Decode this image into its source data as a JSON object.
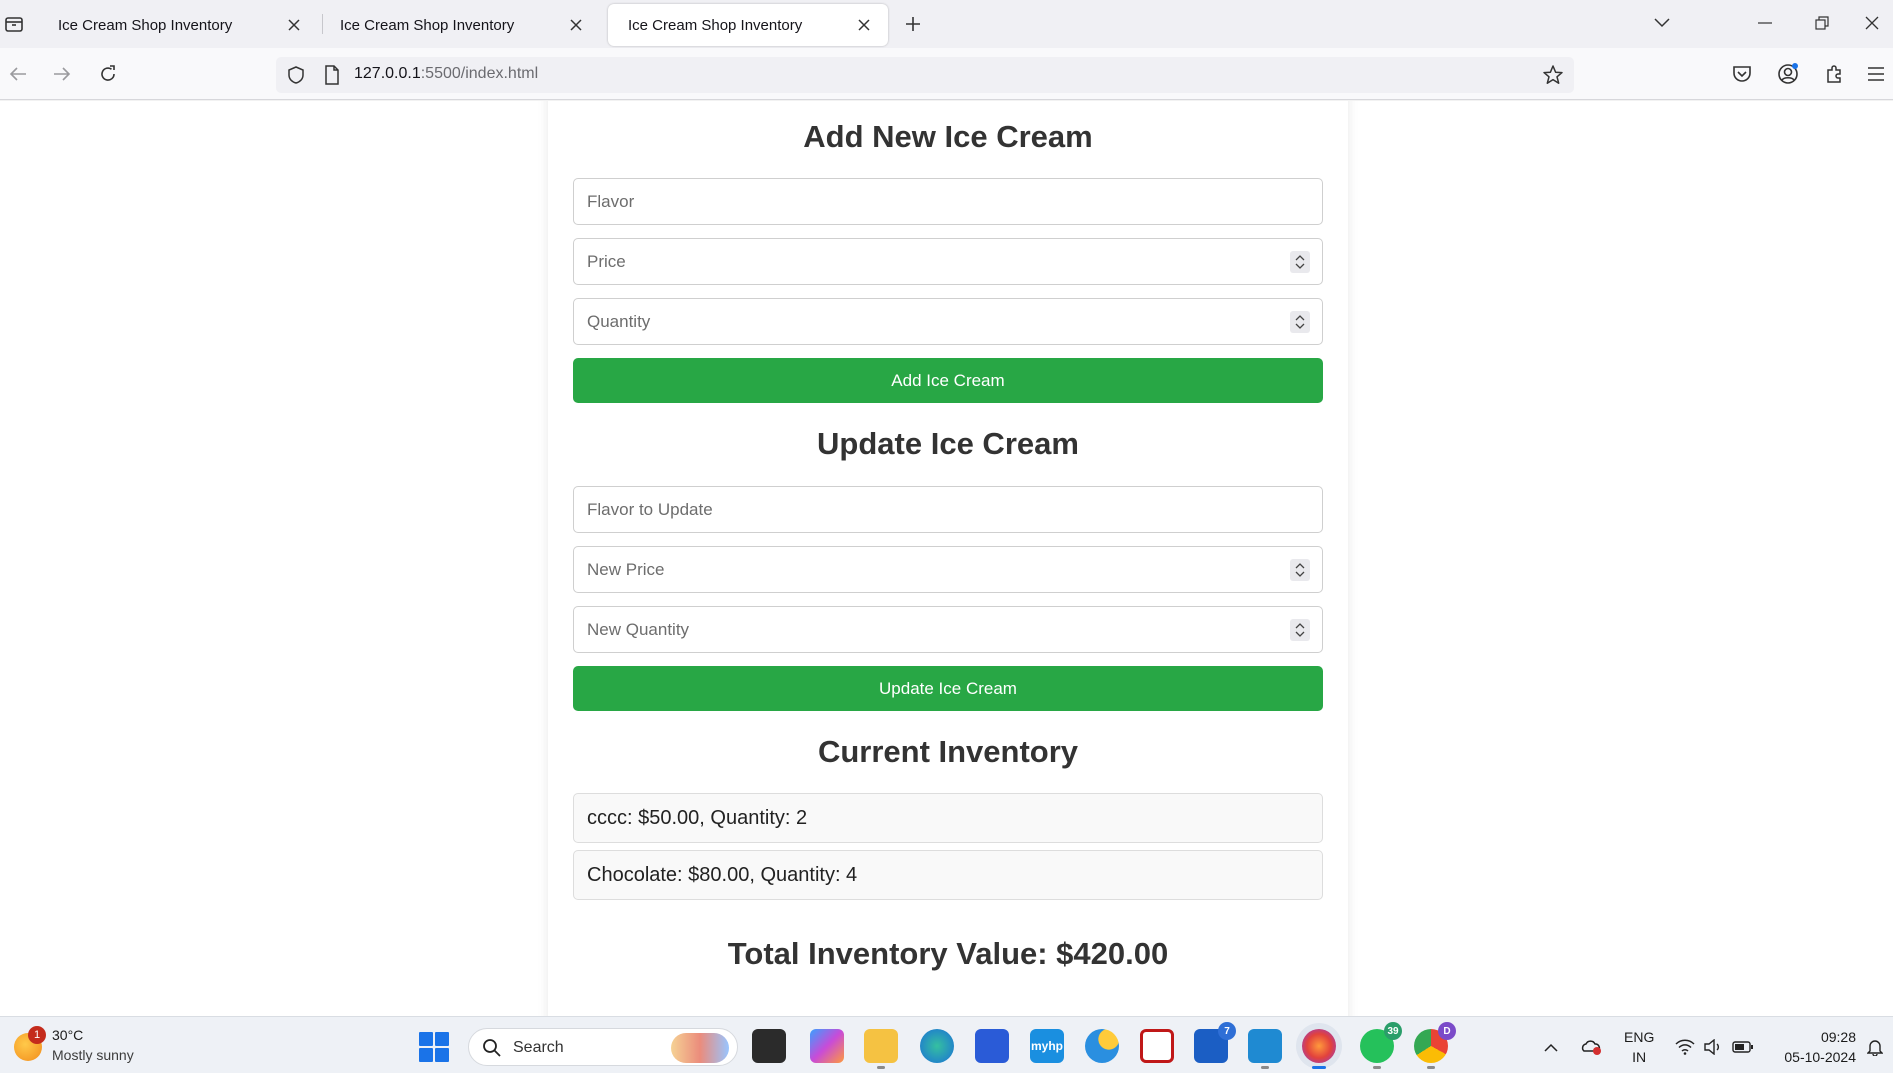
{
  "browser": {
    "tabs": [
      {
        "title": "Ice Cream Shop Inventory",
        "active": false
      },
      {
        "title": "Ice Cream Shop Inventory",
        "active": false
      },
      {
        "title": "Ice Cream Shop Inventory",
        "active": true
      }
    ],
    "url_host": "127.0.0.1",
    "url_rest": ":5500/index.html",
    "icons": {
      "tab_list": "tab-list-icon",
      "close": "close-icon",
      "new_tab": "plus-icon",
      "back": "back-arrow-icon",
      "forward": "forward-arrow-icon",
      "reload": "reload-icon",
      "tracking": "shield-icon",
      "page": "page-icon",
      "bookmark": "star-icon",
      "pocket": "pocket-icon",
      "account": "account-icon",
      "extensions": "puzzle-icon",
      "menu": "hamburger-icon"
    }
  },
  "page": {
    "add_section": {
      "title": "Add New Ice Cream",
      "flavor_placeholder": "Flavor",
      "price_placeholder": "Price",
      "quantity_placeholder": "Quantity",
      "button_label": "Add Ice Cream"
    },
    "update_section": {
      "title": "Update Ice Cream",
      "flavor_placeholder": "Flavor to Update",
      "price_placeholder": "New Price",
      "quantity_placeholder": "New Quantity",
      "button_label": "Update Ice Cream"
    },
    "inventory": {
      "title": "Current Inventory",
      "items": [
        "cccc: $50.00, Quantity: 2",
        "Chocolate: $80.00, Quantity: 4"
      ],
      "total": "Total Inventory Value: $420.00"
    }
  },
  "taskbar": {
    "weather": {
      "badge": "1",
      "temp": "30°C",
      "desc": "Mostly sunny"
    },
    "search_label": "Search",
    "apps": [
      {
        "name": "task-view",
        "badge": ""
      },
      {
        "name": "copilot",
        "badge": ""
      },
      {
        "name": "file-explorer",
        "badge": ""
      },
      {
        "name": "edge",
        "badge": ""
      },
      {
        "name": "microsoft-store",
        "badge": ""
      },
      {
        "name": "myhp",
        "label": "myhp",
        "badge": ""
      },
      {
        "name": "weather-app",
        "badge": ""
      },
      {
        "name": "mcafee",
        "badge": ""
      },
      {
        "name": "store-dark",
        "badge": "7"
      },
      {
        "name": "vscode",
        "badge": ""
      },
      {
        "name": "firefox",
        "badge": ""
      },
      {
        "name": "whatsapp",
        "badge": "39"
      },
      {
        "name": "chrome",
        "badge": "D"
      }
    ],
    "lang_line1": "ENG",
    "lang_line2": "IN",
    "time": "09:28",
    "date": "05-10-2024"
  },
  "colors": {
    "button_green": "#28a745",
    "chrome_bg": "#f0f0f4",
    "taskbar_bg": "#eef1f6"
  }
}
